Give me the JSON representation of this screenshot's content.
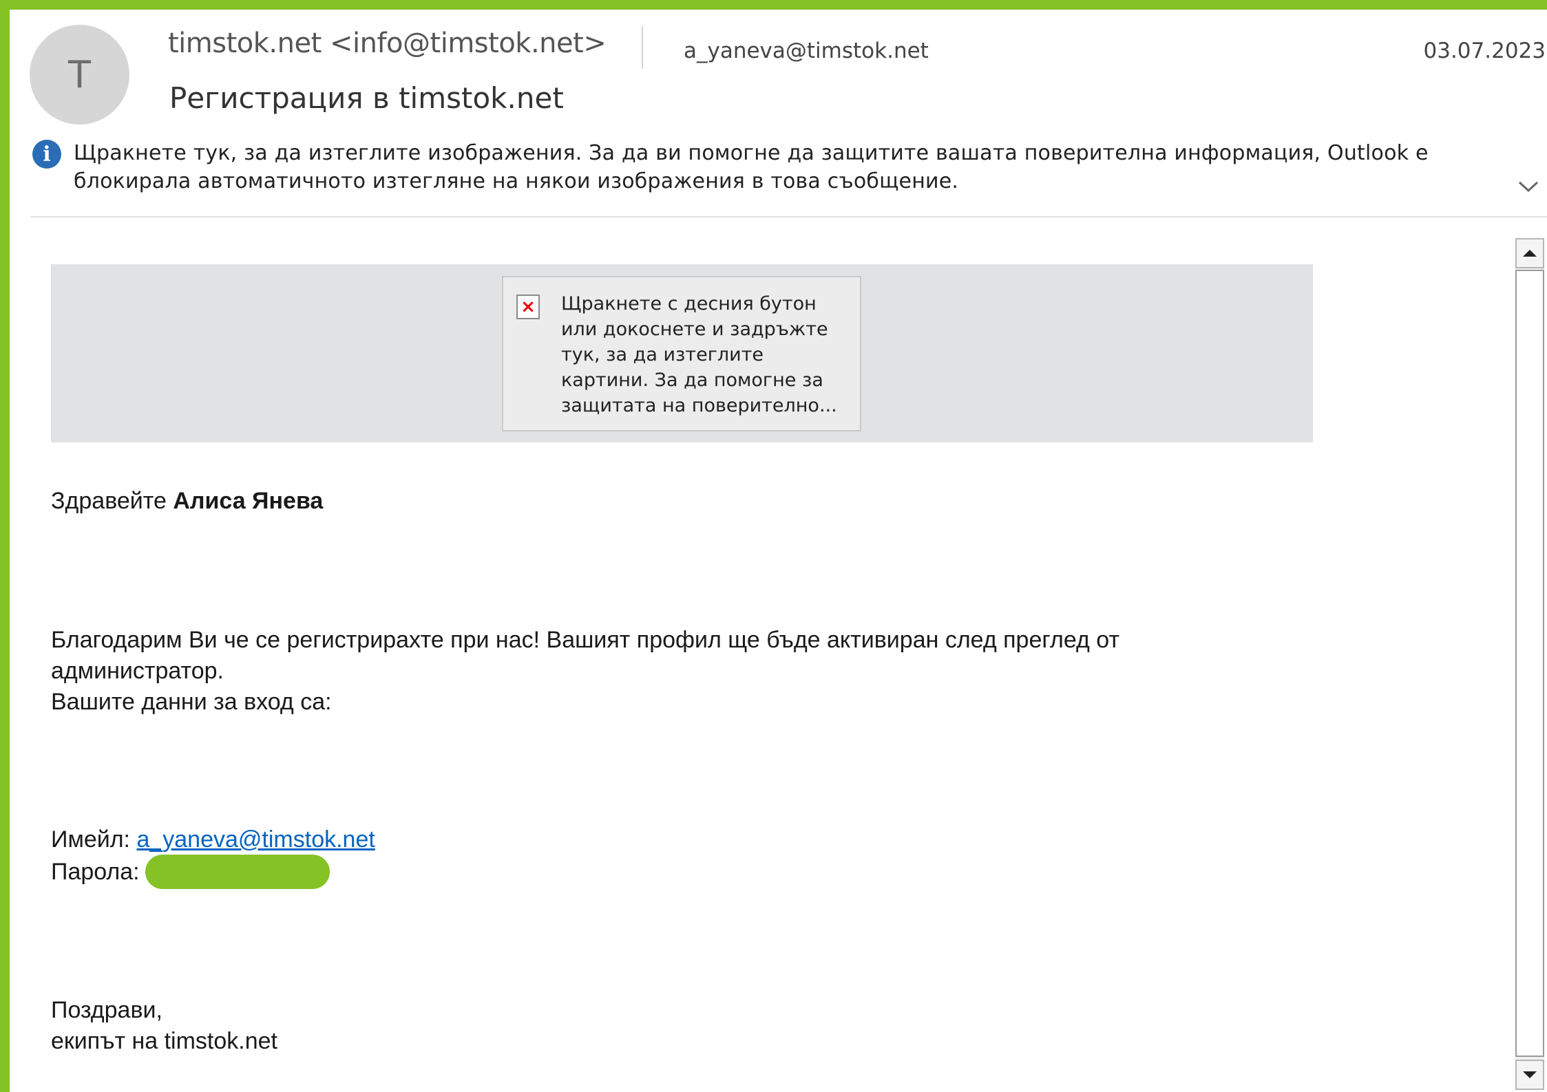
{
  "header": {
    "avatar_initial": "T",
    "sender": "timstok.net <info@timstok.net>",
    "recipient": "a_yaneva@timstok.net",
    "date": "03.07.2023",
    "subject": "Регистрация в timstok.net"
  },
  "infobar": {
    "icon": "info-icon",
    "text": "Щракнете тук, за да изтеглите изображения. За да ви помогне да защитите вашата поверителна информация, Outlook е блокирала автоматичното изтегляне на някои изображения в това съобщение."
  },
  "image_placeholder": {
    "icon": "broken-image-icon",
    "text": "Щракнете с десния бутон\nили докоснете и задръжте\nтук, за да изтеглите\nкартини. За да помогне за\nзащитата на поверително..."
  },
  "body": {
    "greeting_prefix": "Здравейте",
    "greeting_name": "Алиса Янева",
    "thanks_line1": "Благодарим Ви че се регистрирахте при нас! Вашият профил ще бъде активиран след преглед от",
    "thanks_line2": "администратор.",
    "login_intro": "Вашите данни за вход са:",
    "email_label": "Имейл:",
    "email_value": "a_yaneva@timstok.net",
    "password_label": "Парола:",
    "closing": "Поздрави,",
    "signature": "екипът на timstok.net"
  },
  "colors": {
    "frame": "#84c225",
    "link": "#0563c1",
    "info_icon": "#2a6db6",
    "password_mask": "#84c225"
  }
}
